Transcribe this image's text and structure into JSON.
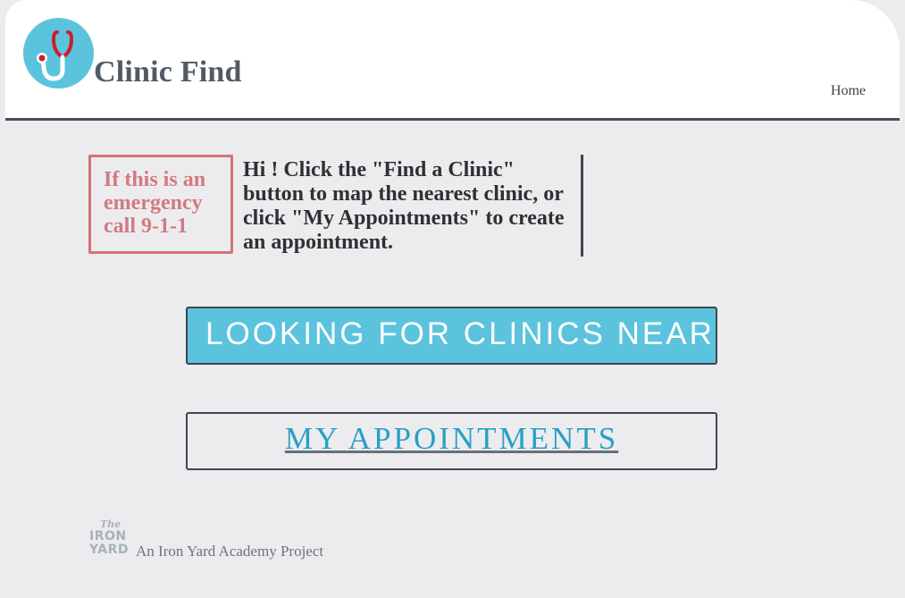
{
  "header": {
    "logo_icon": "stethoscope-icon",
    "title": "Clinic Find",
    "nav": {
      "home_label": "Home"
    }
  },
  "main": {
    "emergency_notice": "If this is an emergency call 9-1-1",
    "intro_text": "Hi ! Click the \"Find a Clinic\" button to map the nearest clinic, or click \"My Appointments\" to create an appointment.",
    "find_clinics_button_label": "LOOKING FOR CLINICS NEAR",
    "appointments_button_label": "MY APPOINTMENTS"
  },
  "footer": {
    "logo_text": {
      "the": "The",
      "iron": "IRON",
      "yard": "YARD"
    },
    "credit": "An Iron Yard Academy Project"
  },
  "colors": {
    "background": "#ececee",
    "accent": "#5bc3dd",
    "emergency": "#d97176",
    "link": "#27a0c6",
    "dark": "#3f454d"
  }
}
